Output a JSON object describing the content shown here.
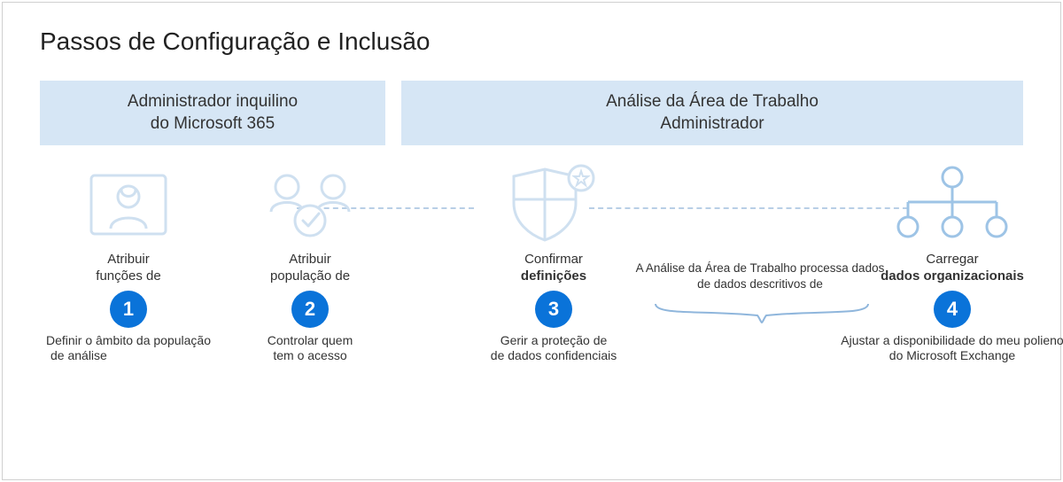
{
  "title": "Passos de Configuração e Inclusão",
  "roles": {
    "tenant_admin_line1": "Administrador inquilino",
    "tenant_admin_line2": "do Microsoft 365",
    "wpa_admin_line1": "Análise da Área de Trabalho",
    "wpa_admin_line2": "Administrador"
  },
  "steps": {
    "s1": {
      "num": "1",
      "title_l1": "Atribuir",
      "title_l2": "funções de",
      "desc_l1": "Definir o âmbito da população",
      "desc_l2": "de análise"
    },
    "s2": {
      "num": "2",
      "title_l1": "Atribuir",
      "title_l2": "população de",
      "desc_l1": "Controlar quem",
      "desc_l2": "tem o acesso"
    },
    "s3": {
      "num": "3",
      "title_l1": "Confirmar",
      "title_l2_bold": "definições",
      "desc_l1": "Gerir a proteção de",
      "desc_l2": "de dados confidenciais"
    },
    "mid_note": {
      "l1": "A Análise da Área de Trabalho processa dados",
      "l2": "de dados descritivos de"
    },
    "s4": {
      "num": "4",
      "title_l1": "Carregar",
      "title_l2_bold": "dados organizacionais",
      "desc_l1": "Ajustar a disponibilidade do meu polieno",
      "desc_l2": "do Microsoft Exchange"
    }
  },
  "colors": {
    "accent": "#0a73d9",
    "header_bg": "#d6e6f5",
    "icon_stroke": "#cfe0f0"
  }
}
